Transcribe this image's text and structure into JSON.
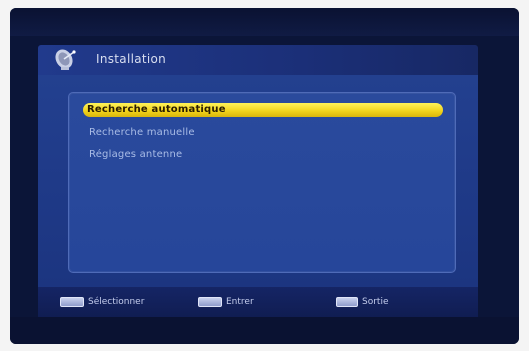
{
  "header": {
    "title": "Installation",
    "icon": "satellite-dish-icon"
  },
  "menu": {
    "items": [
      {
        "label": "Recherche automatique",
        "selected": true
      },
      {
        "label": "Recherche manuelle",
        "selected": false
      },
      {
        "label": "Réglages antenne",
        "selected": false
      }
    ]
  },
  "footer": {
    "hints": [
      {
        "label": "Sélectionner",
        "key_icon": "arrow-keys-icon"
      },
      {
        "label": "Entrer",
        "key_icon": "ok-key-icon"
      },
      {
        "label": "Sortie",
        "key_icon": "exit-key-icon"
      }
    ]
  },
  "colors": {
    "panel": "#1f3a88",
    "highlight": "#f1d21a",
    "text": "#a9bce6"
  }
}
